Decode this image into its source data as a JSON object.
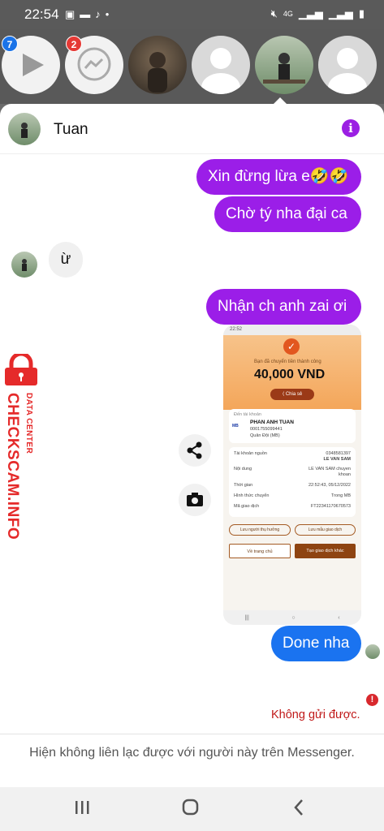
{
  "status_bar": {
    "time": "22:54",
    "network": "4G"
  },
  "chat_heads": [
    {
      "kind": "video-app",
      "badge": "7",
      "badge_color": "#1a73e8"
    },
    {
      "kind": "messenger-app",
      "badge": "2",
      "badge_color": "#e53935"
    },
    {
      "kind": "photo-contact"
    },
    {
      "kind": "default-contact"
    },
    {
      "kind": "active-contact"
    },
    {
      "kind": "default-contact"
    }
  ],
  "conversation": {
    "contact_name": "Tuan",
    "messages": [
      {
        "from": "me",
        "text": "Xin đừng lừa e🤣🤣"
      },
      {
        "from": "me",
        "text": "Chờ tý nha đại ca"
      },
      {
        "from": "them",
        "text": "ừ"
      },
      {
        "from": "me",
        "text": "Nhận ch anh zai ơi"
      },
      {
        "from": "me",
        "text": "Done nha"
      }
    ],
    "error_text": "Không gửi được.",
    "footer_text": "Hiện không liên lạc được với người này trên Messenger."
  },
  "transfer_screenshot": {
    "status_time": "22:52",
    "success_label": "Bạn đã chuyển tiền thành công",
    "amount": "40,000 VND",
    "share_label": "Chia sẻ",
    "to_account_label": "Đến tài khoản",
    "recipient_name": "PHAN ANH TUAN",
    "recipient_account": "0001755099441",
    "bank_line": "Quân Đội (MB)",
    "bank_logo": "MB",
    "rows": [
      {
        "label": "Tài khoản nguồn",
        "value": "0348581397",
        "value2": "LE VAN SAM"
      },
      {
        "label": "Nội dung",
        "value": "LE VAN SAM chuyen",
        "value2": "khoan"
      },
      {
        "label": "Thời gian",
        "value": "22:52:43, 05/12/2022"
      },
      {
        "label": "Hình thức chuyển",
        "value": "Trong MB"
      },
      {
        "label": "Mã giao dịch",
        "value": "FT22341170670573"
      }
    ],
    "save_recipient": "Lưu người thụ hưởng",
    "save_template": "Lưu mẫu giao dịch",
    "home_button": "Về trang chủ",
    "new_transaction": "Tạo giao dịch khác"
  },
  "watermark": {
    "primary": "CHECKSCAM.INFO",
    "secondary": "DATA CENTER"
  },
  "colors": {
    "sent_bubble": "#9b1ee8",
    "last_bubble": "#1a73f0",
    "info_icon": "#9b1fe3",
    "error": "#c01818"
  }
}
